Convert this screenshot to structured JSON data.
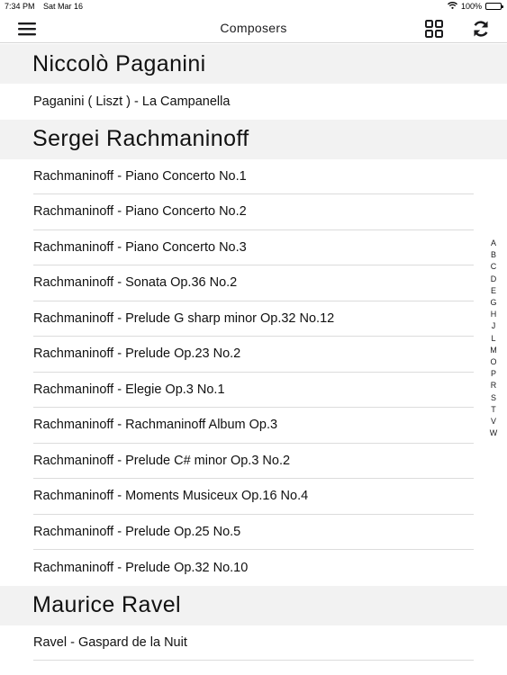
{
  "status": {
    "time": "7:34 PM",
    "date": "Sat Mar 16",
    "battery": "100%"
  },
  "nav": {
    "title": "Composers",
    "icons": {
      "menu": "hamburger-menu-icon",
      "grid": "grid-view-icon",
      "refresh": "refresh-icon"
    }
  },
  "sections": [
    {
      "header": "Niccolò Paganini",
      "items": [
        "Paganini ( Liszt ) - La Campanella"
      ]
    },
    {
      "header": "Sergei Rachmaninoff",
      "items": [
        "Rachmaninoff - Piano Concerto No.1",
        "Rachmaninoff - Piano Concerto No.2",
        "Rachmaninoff - Piano Concerto No.3",
        "Rachmaninoff - Sonata Op.36 No.2",
        "Rachmaninoff - Prelude G sharp minor Op.32 No.12",
        "Rachmaninoff - Prelude Op.23 No.2",
        "Rachmaninoff - Elegie Op.3 No.1",
        "Rachmaninoff - Rachmaninoff Album Op.3",
        "Rachmaninoff - Prelude C# minor Op.3 No.2",
        "Rachmaninoff - Moments Musiceux Op.16 No.4",
        "Rachmaninoff - Prelude Op.25 No.5",
        "Rachmaninoff - Prelude Op.32 No.10"
      ]
    },
    {
      "header": "Maurice Ravel",
      "items": [
        "Ravel - Gaspard de la Nuit"
      ]
    }
  ],
  "index_letters": [
    "A",
    "B",
    "C",
    "D",
    "E",
    "G",
    "H",
    "J",
    "L",
    "M",
    "O",
    "P",
    "R",
    "S",
    "T",
    "V",
    "W"
  ]
}
